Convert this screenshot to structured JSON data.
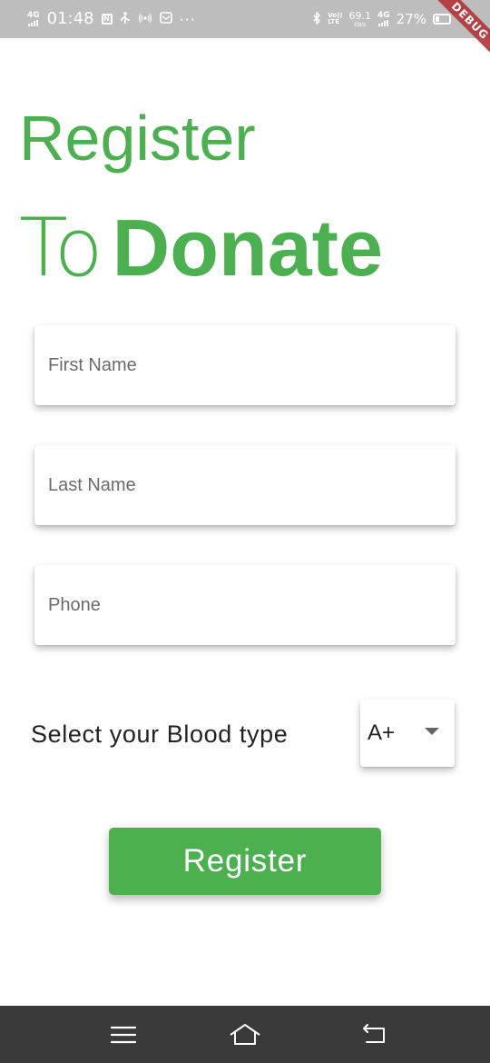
{
  "status_bar": {
    "network_left": "4G",
    "time": "01:48",
    "notif_box_glyph": "N",
    "more_dots": "···",
    "volte_top": "Vo))",
    "volte_bottom": "LTE",
    "speed_value": "69.1",
    "speed_unit": "KB/s",
    "network_right": "4G",
    "battery_percent": "27%",
    "battery_level": 0.27,
    "icons": [
      "signal-icon",
      "usb-icon",
      "hotspot-icon",
      "mail-icon",
      "bluetooth-icon",
      "charging-icon"
    ]
  },
  "debug_banner": "DEBUG",
  "heading": {
    "line1": "Register",
    "line2_light": "To",
    "line2_bold": "Donate"
  },
  "form": {
    "first_name": {
      "placeholder": "First Name",
      "value": ""
    },
    "last_name": {
      "placeholder": "Last Name",
      "value": ""
    },
    "phone": {
      "placeholder": "Phone",
      "value": ""
    },
    "blood_type_label": "Select your Blood type",
    "blood_type_selected": "A+"
  },
  "register_button": "Register",
  "nav_bar": {
    "icons": [
      "menu-icon",
      "home-icon",
      "back-icon"
    ]
  },
  "colors": {
    "accent": "#4caf50",
    "status_bar": "#bdbdbd",
    "nav_bar": "#3a3a3a",
    "debug_ribbon": "#b03438"
  }
}
